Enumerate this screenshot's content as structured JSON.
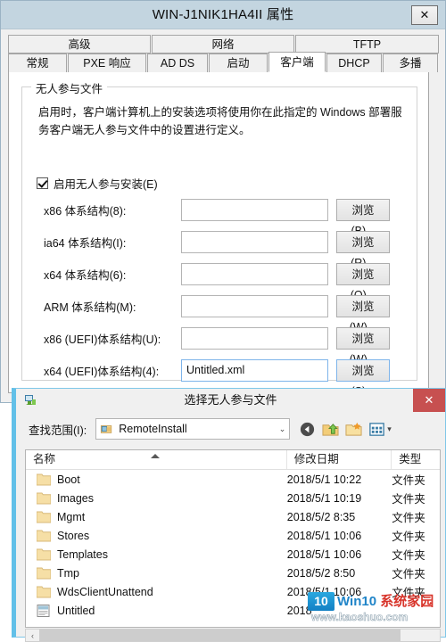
{
  "properties_dialog": {
    "title": "WIN-J1NIK1HA4II 属性",
    "close_label": "✕",
    "tabs_row1": [
      {
        "label": "高级",
        "active": false
      },
      {
        "label": "网络",
        "active": false
      },
      {
        "label": "TFTP",
        "active": false
      }
    ],
    "tabs_row2": [
      {
        "label": "常规",
        "active": false
      },
      {
        "label": "PXE 响应",
        "active": false
      },
      {
        "label": "AD DS",
        "active": false
      },
      {
        "label": "启动",
        "active": false
      },
      {
        "label": "客户端",
        "active": true
      },
      {
        "label": "DHCP",
        "active": false
      },
      {
        "label": "多播",
        "active": false
      }
    ],
    "group": {
      "legend": "无人参与文件",
      "description": "启用时，客户端计算机上的安装选项将使用你在此指定的 Windows 部署服务客户端无人参与文件中的设置进行定义。",
      "checkbox_label": "启用无人参与安装(E)",
      "checkbox_checked": true
    },
    "fields": [
      {
        "label": "x86 体系结构(8):",
        "value": "",
        "button": "浏览(B)...",
        "focused": false,
        "button_highlight": false
      },
      {
        "label": "ia64 体系结构(I):",
        "value": "",
        "button": "浏览(R)...",
        "focused": false,
        "button_highlight": false
      },
      {
        "label": "x64 体系结构(6):",
        "value": "",
        "button": "浏览(O)...",
        "focused": false,
        "button_highlight": false
      },
      {
        "label": "ARM 体系结构(M):",
        "value": "",
        "button": "浏览(W)...",
        "focused": false,
        "button_highlight": false
      },
      {
        "label": "x86 (UEFI)体系结构(U):",
        "value": "",
        "button": "浏览(W)...",
        "focused": false,
        "button_highlight": false
      },
      {
        "label": "x64 (UEFI)体系结构(4):",
        "value": "Untitled.xml",
        "button": "浏览(S)...",
        "focused": true,
        "button_highlight": true
      }
    ]
  },
  "file_dialog": {
    "title": "选择无人参与文件",
    "close_label": "✕",
    "lookin_label": "查找范围(I):",
    "lookin_value": "RemoteInstall",
    "nav_icons": [
      "back-icon",
      "up-folder-icon",
      "new-folder-icon",
      "views-icon"
    ],
    "columns": [
      {
        "key": "name",
        "label": "名称"
      },
      {
        "key": "date",
        "label": "修改日期"
      },
      {
        "key": "type",
        "label": "类型"
      }
    ],
    "sorted_column": "name",
    "sort_direction": "asc",
    "rows": [
      {
        "icon": "folder-icon",
        "name": "Boot",
        "date": "2018/5/1 10:22",
        "type": "文件夹"
      },
      {
        "icon": "folder-icon",
        "name": "Images",
        "date": "2018/5/1 10:19",
        "type": "文件夹"
      },
      {
        "icon": "folder-icon",
        "name": "Mgmt",
        "date": "2018/5/2 8:35",
        "type": "文件夹"
      },
      {
        "icon": "folder-icon",
        "name": "Stores",
        "date": "2018/5/1 10:06",
        "type": "文件夹"
      },
      {
        "icon": "folder-icon",
        "name": "Templates",
        "date": "2018/5/1 10:06",
        "type": "文件夹"
      },
      {
        "icon": "folder-icon",
        "name": "Tmp",
        "date": "2018/5/2 8:50",
        "type": "文件夹"
      },
      {
        "icon": "folder-icon",
        "name": "WdsClientUnattend",
        "date": "2018/5/1 10:06",
        "type": "文件夹"
      },
      {
        "icon": "xml-file-icon",
        "name": "Untitled",
        "date": "2018",
        "type": ""
      }
    ],
    "hscroll_left_label": "‹"
  },
  "watermark": {
    "badge": "10",
    "main_blue": "Win10 ",
    "main_red": "系统家园",
    "url": "www.kaoshuo.com"
  },
  "colors": {
    "titlebar": "#c3d5e0",
    "close_red": "#c75050",
    "accent_border": "#62c0e8",
    "focus_blue": "#7eb4ea"
  }
}
